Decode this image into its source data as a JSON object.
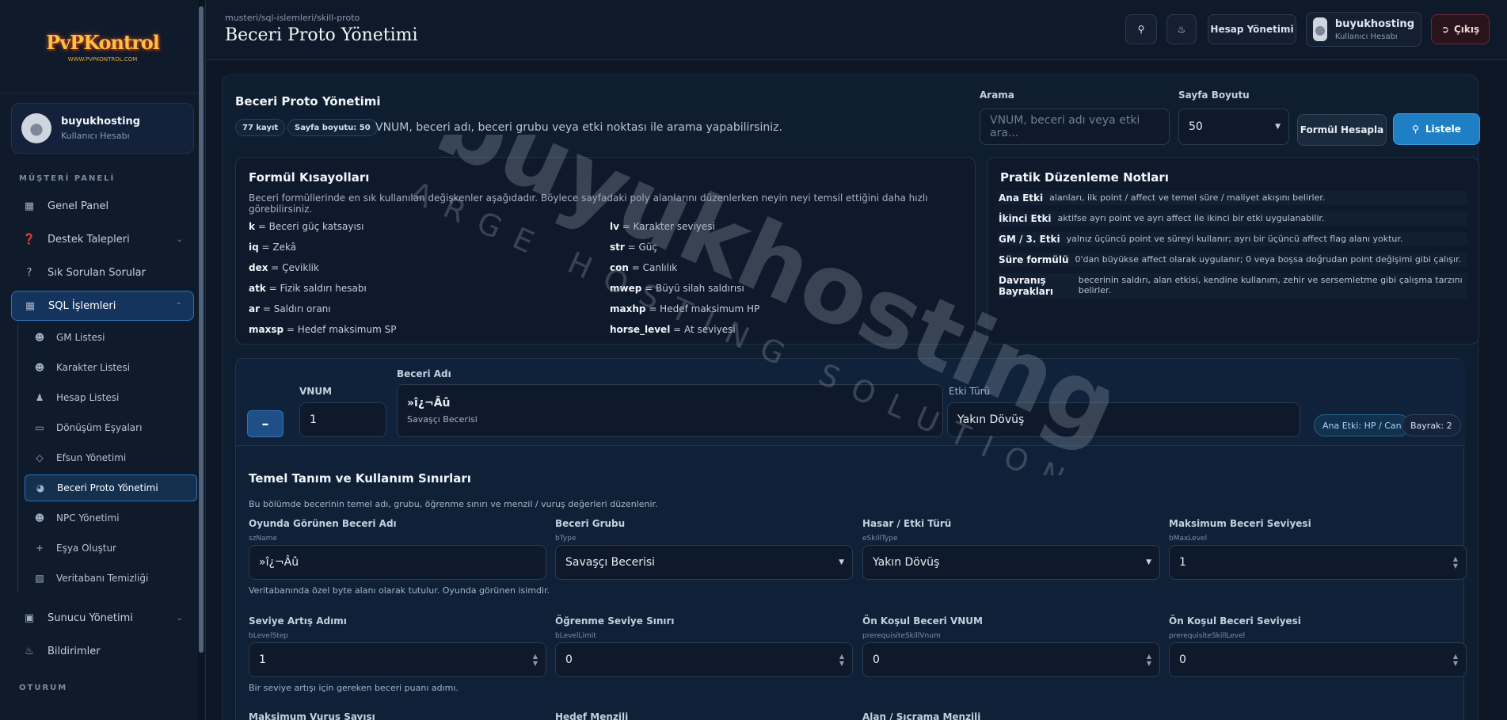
{
  "app": {
    "logo_text": "PvPKontrol",
    "logo_sub": "WWW.PVPKONTROL.COM"
  },
  "sidebar": {
    "user": {
      "name": "buyukhosting",
      "role": "Kullanıcı Hesabı"
    },
    "section_label": "MÜŞTERİ PANELİ",
    "items": [
      {
        "label": "Genel Panel",
        "icon": "dashboard-icon"
      },
      {
        "label": "Destek Talepleri",
        "icon": "help-circle-icon"
      },
      {
        "label": "Sık Sorulan Sorular",
        "icon": "question-icon"
      },
      {
        "label": "SQL İşlemleri",
        "icon": "grid-icon"
      }
    ],
    "sql_sub_items": [
      {
        "label": "GM Listesi",
        "icon": "users-icon"
      },
      {
        "label": "Karakter Listesi",
        "icon": "users-icon"
      },
      {
        "label": "Hesap Listesi",
        "icon": "user-icon"
      },
      {
        "label": "Dönüşüm Eşyaları",
        "icon": "capsule-icon"
      },
      {
        "label": "Efsun Yönetimi",
        "icon": "diamond-icon"
      },
      {
        "label": "Beceri Proto Yönetimi",
        "icon": "skill-icon"
      },
      {
        "label": "NPC Yönetimi",
        "icon": "users-icon"
      },
      {
        "label": "Eşya Oluştur",
        "icon": "plus-icon"
      },
      {
        "label": "Veritabanı Temizliği",
        "icon": "trash-icon"
      }
    ],
    "bottom_items": [
      {
        "label": "Sunucu Yönetimi",
        "icon": "monitor-icon"
      },
      {
        "label": "Bildirimler",
        "icon": "bell-icon"
      }
    ],
    "footer_label": "OTURUM"
  },
  "topbar": {
    "breadcrumb": "musteri/sql-islemleri/skill-proto",
    "title": "Beceri Proto Yönetimi",
    "account_button": "Hesap Yönetimi",
    "user": {
      "name": "buyukhosting",
      "role": "Kullanıcı Hesabı"
    },
    "logout_label": "Çıkış"
  },
  "main": {
    "title": "Beceri Proto Yönetimi",
    "record_chip": "77 kayıt",
    "page_size_chip": "Sayfa boyutu: 50",
    "hint": "VNUM, beceri adı, beceri grubu veya etki noktası ile arama yapabilirsiniz.",
    "search_label": "Arama",
    "search_placeholder": "VNUM, beceri adı veya etki ara...",
    "page_size_label": "Sayfa Boyutu",
    "page_size_value": "50",
    "formula_button": "Formül Hesapla",
    "list_button": "Listele"
  },
  "formula": {
    "title": "Formül Kısayolları",
    "subtitle": "Beceri formüllerinde en sık kullanılan değişkenler aşağıdadır. Böylece sayfadaki poly alanlarını düzenlerken neyin neyi temsil ettiğini daha hızlı görebilirsiniz.",
    "left": [
      {
        "k": "k",
        "v": "= Beceri güç katsayısı"
      },
      {
        "k": "iq",
        "v": "= Zekâ"
      },
      {
        "k": "dex",
        "v": "= Çeviklik"
      },
      {
        "k": "atk",
        "v": "= Fizik saldırı hesabı"
      },
      {
        "k": "ar",
        "v": "= Saldırı oranı"
      },
      {
        "k": "maxsp",
        "v": "= Hedef maksimum SP"
      }
    ],
    "right": [
      {
        "k": "lv",
        "v": "= Karakter seviyesi"
      },
      {
        "k": "str",
        "v": "= Güç"
      },
      {
        "k": "con",
        "v": "= Canlılık"
      },
      {
        "k": "mwep",
        "v": "= Büyü silah saldırısı"
      },
      {
        "k": "maxhp",
        "v": "= Hedef maksimum HP"
      },
      {
        "k": "horse_level",
        "v": "= At seviyesi"
      }
    ]
  },
  "notes": {
    "title": "Pratik Düzenleme Notları",
    "items": [
      {
        "k": "Ana Etki",
        "v": "alanları, ilk point / affect ve temel süre / maliyet akışını belirler."
      },
      {
        "k": "İkinci Etki",
        "v": "aktifse ayrı point ve ayrı affect ile ikinci bir etki uygulanabilir."
      },
      {
        "k": "GM / 3. Etki",
        "v": "yalnız üçüncü point ve süreyi kullanır; ayrı bir üçüncü affect flag alanı yoktur."
      },
      {
        "k": "Süre formülü",
        "v": "0'dan büyükse affect olarak uygulanır; 0 veya boşsa doğrudan point değişimi gibi çalışır."
      },
      {
        "k": "Davranış Bayrakları",
        "v": "becerinin saldırı, alan etkisi, kendine kullanım, zehir ve sersemletme gibi çalışma tarzını belirler."
      }
    ]
  },
  "skill": {
    "vnum_label": "VNUM",
    "vnum_value": "1",
    "name_label": "Beceri Adı",
    "name_value": "»î¿¬Âû",
    "group_value": "Savaşçı Becerisi",
    "type_label": "Etki Türü",
    "type_value": "Yakın Dövüş",
    "main_effect_pill": "Ana Etki: HP / Can",
    "flag_pill": "Bayrak: 2",
    "section_title": "Temel Tanım ve Kullanım Sınırları",
    "section_sub": "Bu bölümde becerinin temel adı, grubu, öğrenme sınırı ve menzil / vuruş değerleri düzenlenir.",
    "fields_row1": [
      {
        "label": "Oyunda Görünen Beceri Adı",
        "key": "szName",
        "value": "»î¿¬Âû"
      },
      {
        "label": "Beceri Grubu",
        "key": "bType",
        "value": "Savaşçı Becerisi"
      },
      {
        "label": "Hasar / Etki Türü",
        "key": "eSkillType",
        "value": "Yakın Dövüş"
      },
      {
        "label": "Maksimum Beceri Seviyesi",
        "key": "bMaxLevel",
        "value": "1"
      }
    ],
    "help_row1": "Veritabanında özel byte alanı olarak tutulur. Oyunda görünen isimdir.",
    "fields_row2": [
      {
        "label": "Seviye Artış Adımı",
        "key": "bLevelStep",
        "value": "1"
      },
      {
        "label": "Öğrenme Seviye Sınırı",
        "key": "bLevelLimit",
        "value": "0"
      },
      {
        "label": "Ön Koşul Beceri VNUM",
        "key": "prerequisiteSkillVnum",
        "value": "0"
      },
      {
        "label": "Ön Koşul Beceri Seviyesi",
        "key": "prerequisiteSkillLevel",
        "value": "0"
      }
    ],
    "help_row2": "Bir seviye artışı için gereken beceri puanı adımı.",
    "fields_row3_labels": [
      "Maksimum Vuruş Sayısı",
      "Hedef Menzili",
      "Alan / Sıçrama Menzili"
    ]
  },
  "watermark": {
    "main": "buyukhosting",
    "sub": "LARGE HOSTING SOLUTIONS"
  }
}
